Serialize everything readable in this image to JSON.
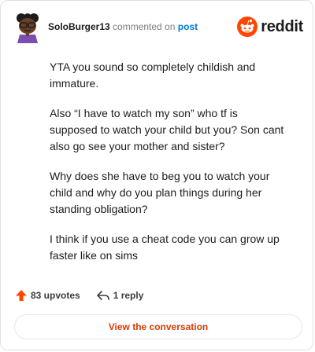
{
  "header": {
    "username": "SoloBurger13",
    "action_text": "commented on",
    "post_link": "post",
    "brand": "reddit"
  },
  "comment": {
    "paragraphs": [
      "YTA you sound so completely childish and immature.",
      "Also “I have to watch my son” who tf is supposed to watch your child but you? Son cant also go see your mother and sister?",
      "Why does she have to beg you to watch your child and why do you plan things during her standing obligation?",
      "I think if you use a cheat code you can grow up faster like on sims"
    ]
  },
  "footer": {
    "upvotes": "83 upvotes",
    "replies": "1 reply"
  },
  "cta": {
    "label": "View the conversation"
  },
  "colors": {
    "brand_orange": "#ff4500",
    "link_blue": "#0079d3",
    "cta_text": "#d93a00"
  }
}
